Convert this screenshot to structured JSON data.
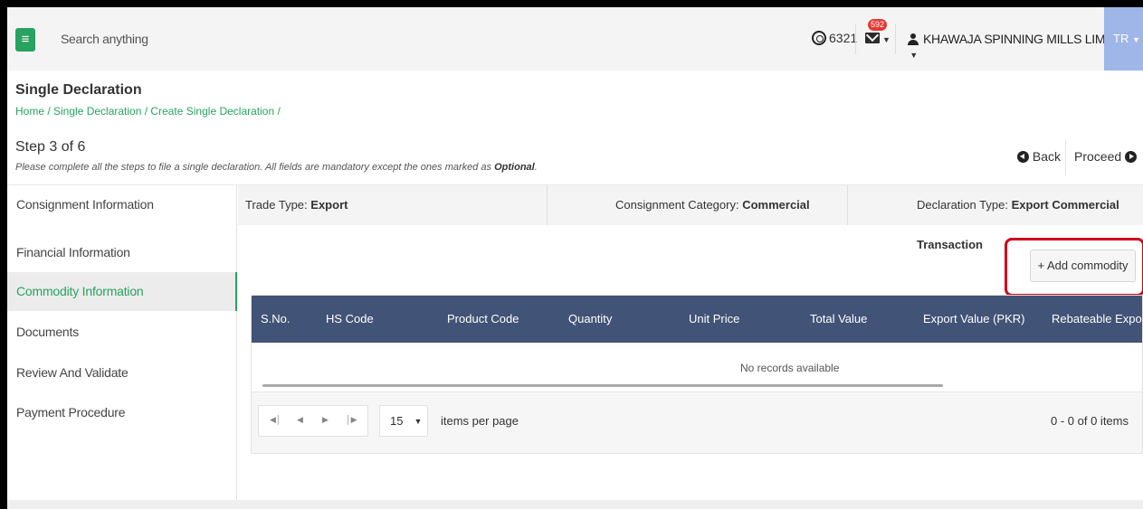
{
  "header": {
    "search_placeholder": "Search anything",
    "token_count": "6321",
    "mail_badge": "592",
    "company": "KHAWAJA SPINNING MILLS LIMITED",
    "user_initials": "TR"
  },
  "page": {
    "title": "Single Declaration",
    "breadcrumb": "Home / Single Declaration / Create Single Declaration /",
    "step": "Step 3 of 6",
    "description": "Please complete all the steps to file a single declaration. All fields are mandatory except the ones marked as",
    "optional_word": "Optional",
    "back_label": "Back",
    "proceed_label": "Proceed"
  },
  "sidebar": {
    "items": [
      {
        "label": "Consignment Information"
      },
      {
        "label": "Financial Information"
      },
      {
        "label": "Commodity Information"
      },
      {
        "label": "Documents"
      },
      {
        "label": "Review And Validate"
      },
      {
        "label": "Payment Procedure"
      }
    ],
    "active_index": 2
  },
  "info": {
    "trade_type_label": "Trade Type:",
    "trade_type_value": "Export",
    "category_label": "Consignment Category:",
    "category_value": "Commercial",
    "decl_type_label": "Declaration Type:",
    "decl_type_value": "Export Commercial Transaction"
  },
  "commodity": {
    "add_label": "+ Add commodity",
    "columns": [
      "S.No.",
      "HS Code",
      "Product Code",
      "Quantity",
      "Unit Price",
      "Total Value",
      "Export Value (PKR)",
      "Rebateable Export V"
    ],
    "empty_text": "No records available",
    "page_size": "15",
    "per_page_label": "items per page",
    "pager_info": "0 - 0 of 0 items"
  },
  "colors": {
    "accent_green": "#27a35f",
    "grid_header": "#415376",
    "highlight_red": "#d0021b"
  }
}
